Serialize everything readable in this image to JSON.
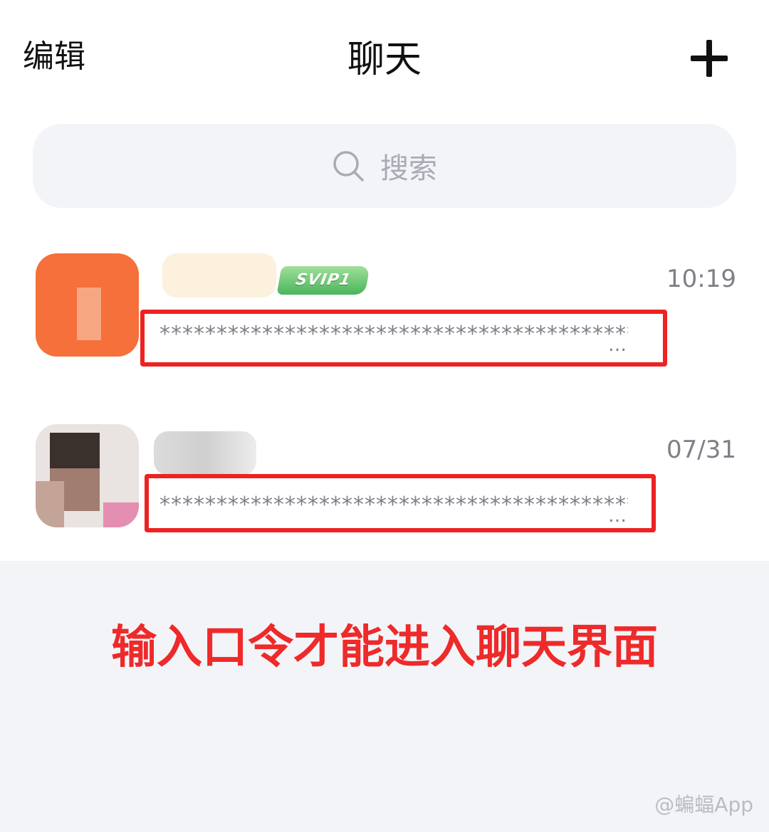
{
  "header": {
    "edit_label": "编辑",
    "title": "聊天"
  },
  "search": {
    "placeholder": "搜索"
  },
  "conversations": [
    {
      "badge": "SVIP1",
      "preview": "*******************************************",
      "ellipsis": "…",
      "time": "10:19"
    },
    {
      "preview": "*******************************************",
      "ellipsis": "…",
      "time": "07/31"
    }
  ],
  "notice": "输入口令才能进入聊天界面",
  "watermark": "@蝙蝠App",
  "colors": {
    "highlight": "#ee2222",
    "notice_text": "#ee2a2a",
    "avatar_orange": "#f5703a",
    "search_bg": "#f3f4f8"
  },
  "icons": {
    "add": "plus-icon",
    "search": "search-icon"
  }
}
